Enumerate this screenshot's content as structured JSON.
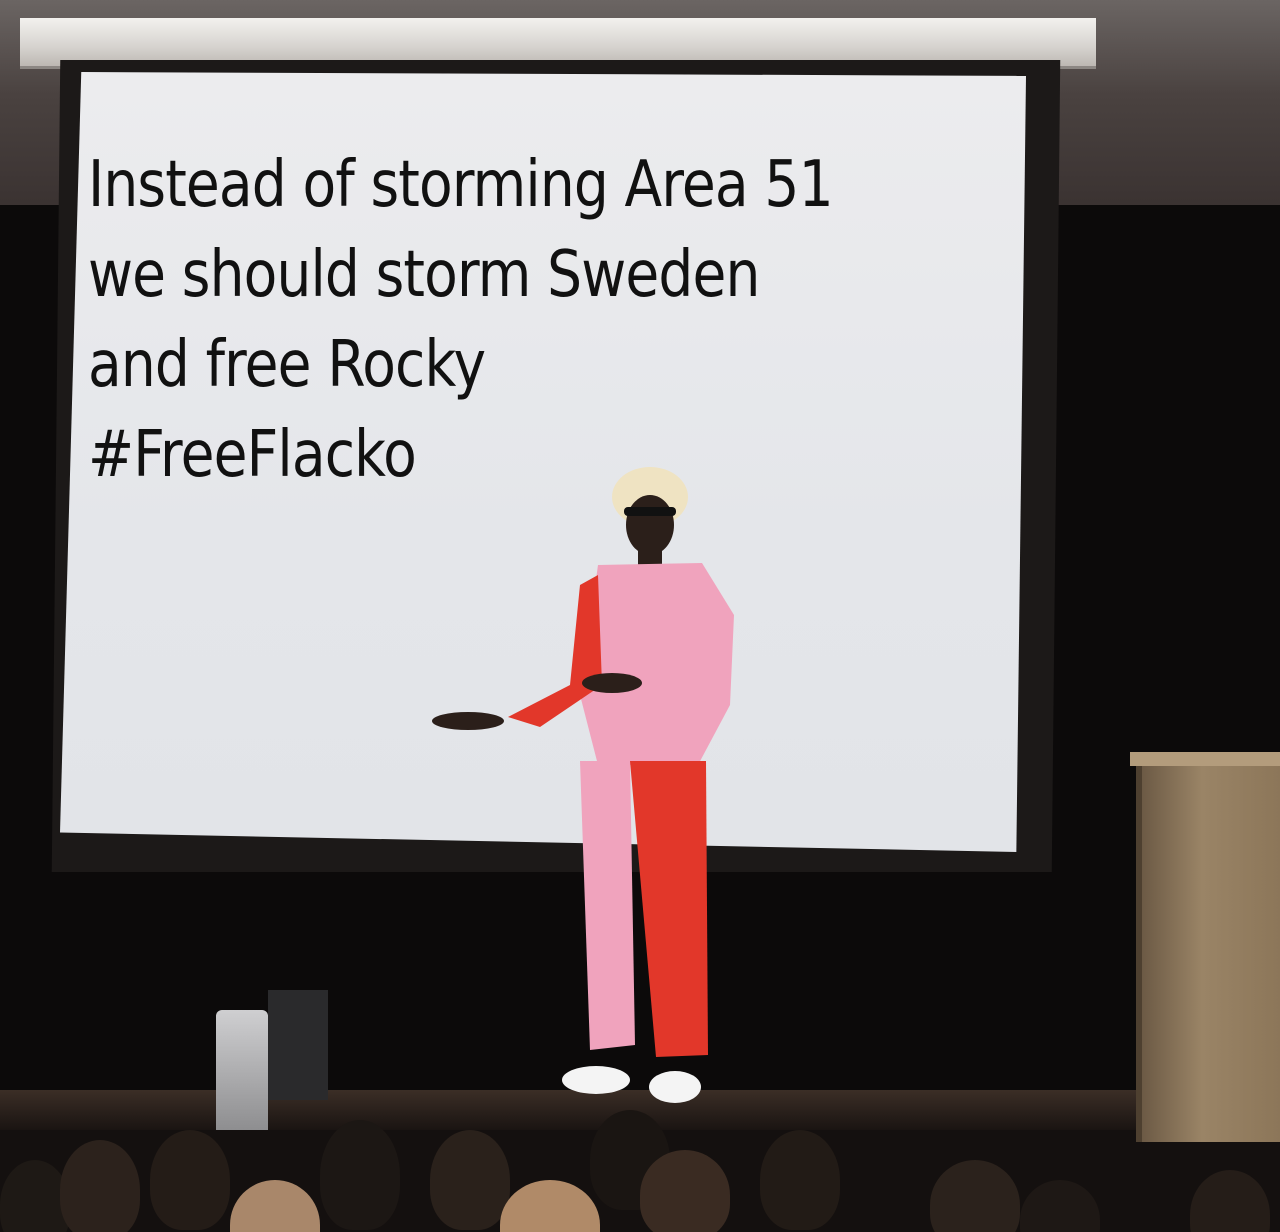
{
  "meme": {
    "caption_lines": [
      "Instead of storming Area 51",
      "we should storm Sweden",
      "and free Rocky",
      "#FreeFlacko"
    ]
  },
  "colors": {
    "screen": "#e4e6ea",
    "caption_text": "#111111",
    "suit_pink": "#f0a3bd",
    "suit_red": "#e2372a",
    "podium_wood": "#9a8466",
    "stage_dark": "#0c0a0a"
  }
}
